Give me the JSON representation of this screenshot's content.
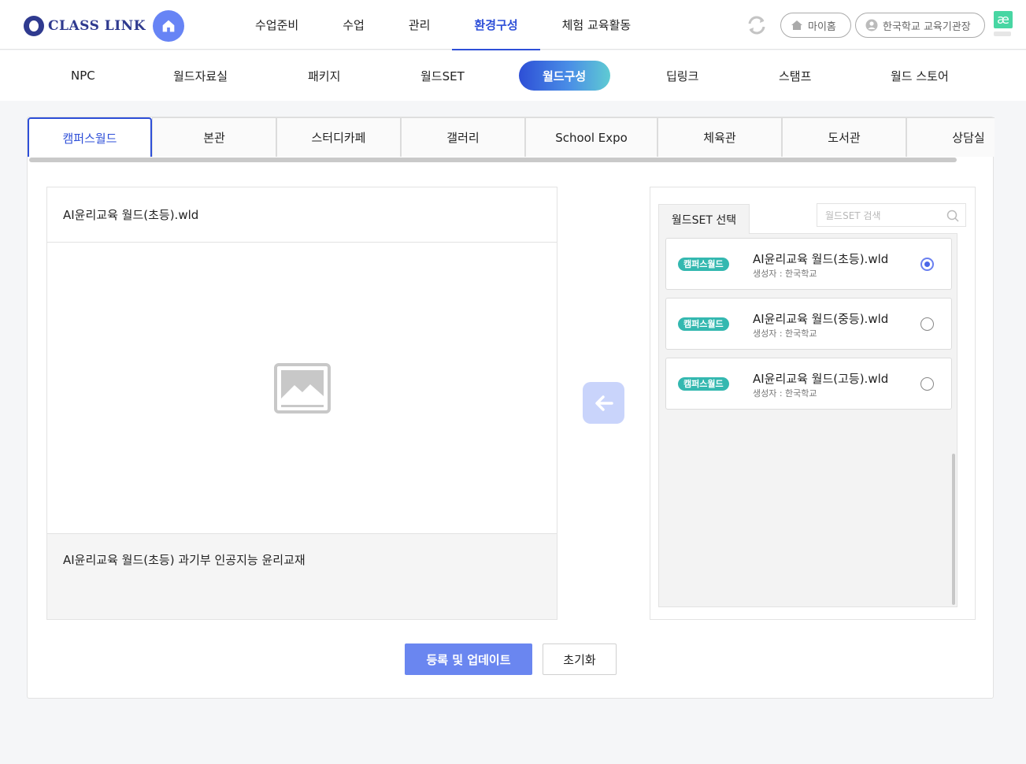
{
  "header": {
    "logo_text": "CLASS LINK",
    "nav": [
      "수업준비",
      "수업",
      "관리",
      "환경구성",
      "체험 교육활동"
    ],
    "active_nav": "환경구성",
    "my_home": "마이홈",
    "org": "한국학교 교육기관장",
    "ae_label": "æ"
  },
  "subnav": {
    "items": [
      "NPC",
      "월드자료실",
      "패키지",
      "월드SET",
      "월드구성",
      "딥링크",
      "스탬프",
      "월드 스토어"
    ],
    "active": "월드구성"
  },
  "tabs": {
    "items": [
      "캠퍼스월드",
      "본관",
      "스터디카페",
      "갤러리",
      "School Expo",
      "체육관",
      "도서관",
      "상담실"
    ],
    "active": "캠퍼스월드"
  },
  "preview": {
    "title": "AI윤리교육 월드(초등).wld",
    "description": "AI윤리교육 월드(초등) 과기부 인공지능 윤리교재"
  },
  "selector": {
    "tab_label": "월드SET 선택",
    "search_placeholder": "월드SET 검색",
    "items": [
      {
        "badge": "캠퍼스월드",
        "name": "AI윤리교육 월드(초등).wld",
        "creator": "생성자 : 한국학교",
        "selected": true
      },
      {
        "badge": "캠퍼스월드",
        "name": "AI윤리교육 월드(중등).wld",
        "creator": "생성자 : 한국학교",
        "selected": false
      },
      {
        "badge": "캠퍼스월드",
        "name": "AI윤리교육 월드(고등).wld",
        "creator": "생성자 : 한국학교",
        "selected": false
      }
    ]
  },
  "actions": {
    "register": "등록 및 업데이트",
    "reset": "초기화"
  },
  "colors": {
    "accent": "#2e4fd8",
    "primary_button": "#6a86f0",
    "badge": "#34b8b0"
  }
}
